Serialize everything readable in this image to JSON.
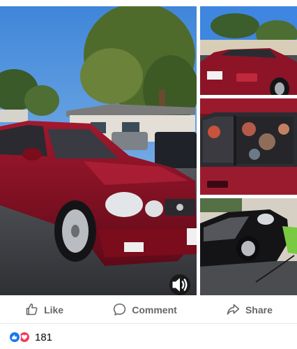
{
  "post": {
    "images": [
      {
        "id": "main",
        "icon": "car-front-three-quarter-photo"
      },
      {
        "id": "thumb-1",
        "icon": "car-rear-photo"
      },
      {
        "id": "thumb-2",
        "icon": "car-interior-window-curtain-photo"
      },
      {
        "id": "thumb-3",
        "icon": "car-side-cleaning-photo"
      }
    ],
    "sound_icon": "speaker-icon"
  },
  "actions": {
    "like_label": "Like",
    "comment_label": "Comment",
    "share_label": "Share"
  },
  "reactions": {
    "count": "181",
    "types": [
      "like",
      "love"
    ]
  },
  "colors": {
    "like_blue": "#1877f2",
    "love_red": "#f33e58",
    "action_gray": "#65676b",
    "car_red": "#8a1024"
  }
}
